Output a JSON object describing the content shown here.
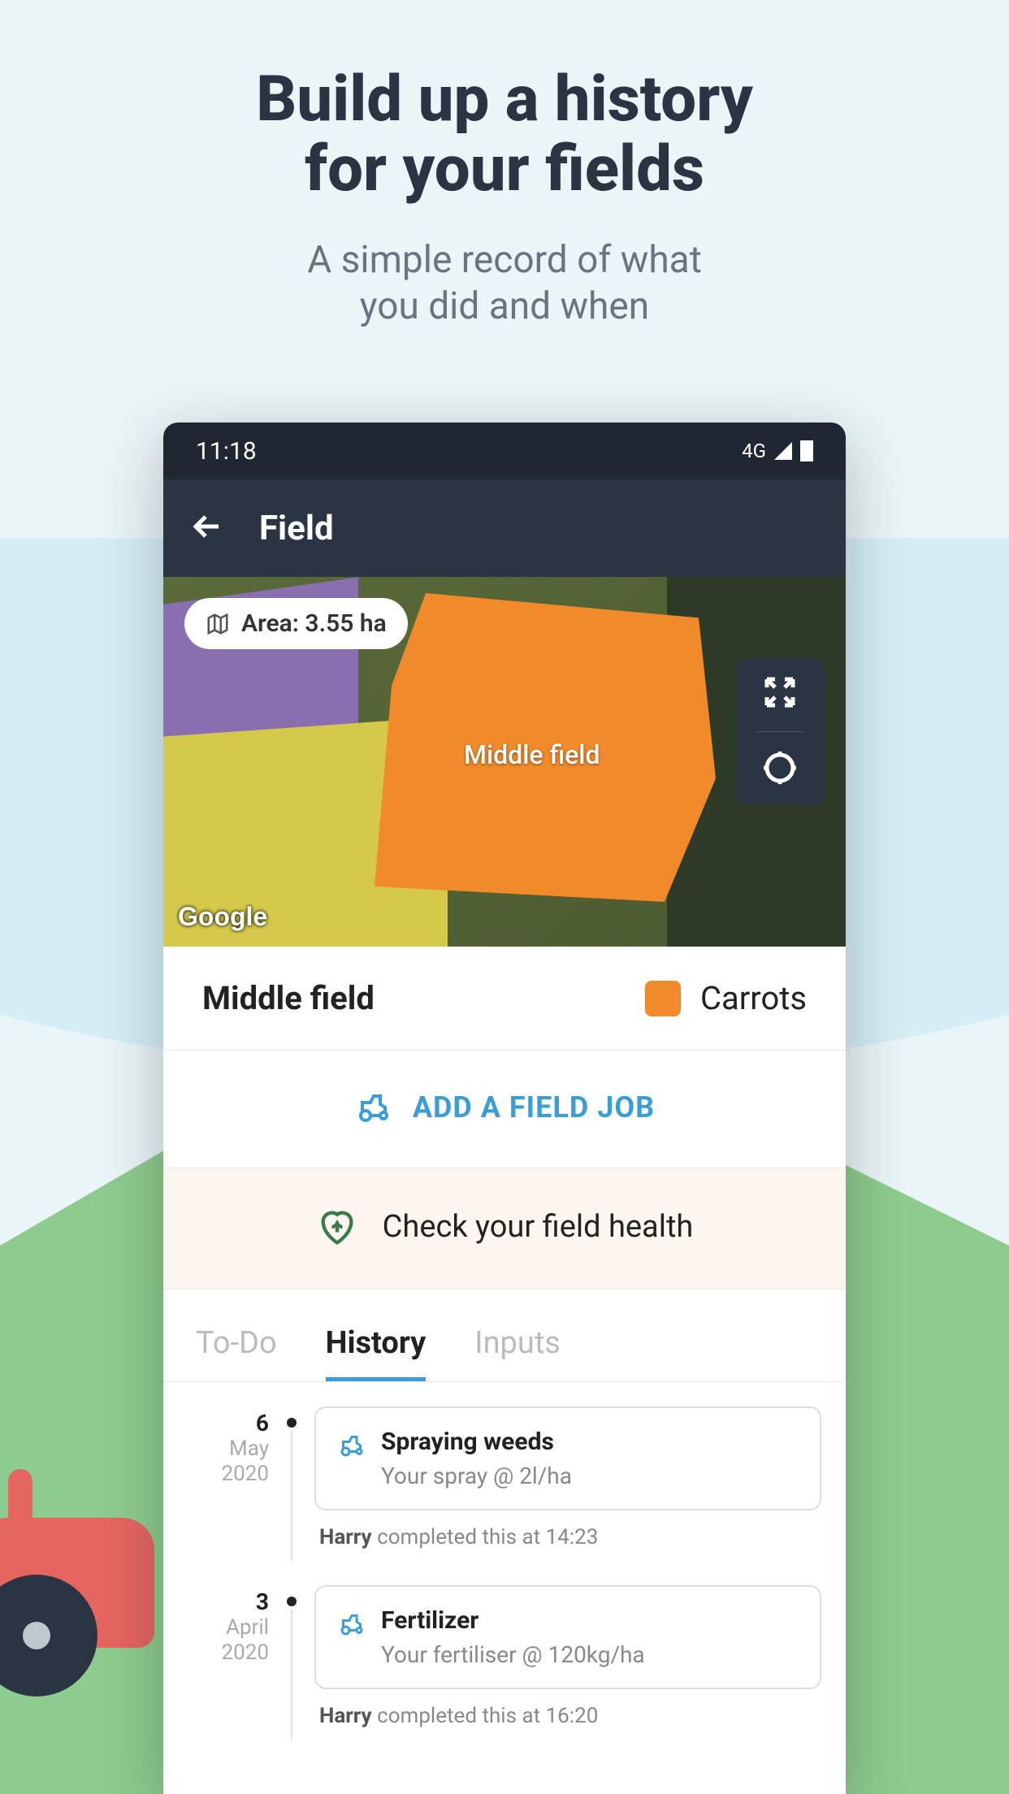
{
  "promo": {
    "title_l1": "Build up a history",
    "title_l2": "for your fields",
    "sub_l1": "A simple record of what",
    "sub_l2": "you did and when"
  },
  "status": {
    "time": "11:18",
    "network": "4G"
  },
  "appbar": {
    "title": "Field"
  },
  "map": {
    "area_label": "Area: 3.55 ha",
    "field_label": "Middle field",
    "watermark": "Google"
  },
  "field_info": {
    "name": "Middle field",
    "crop": "Carrots",
    "crop_color": "#f08a2a"
  },
  "actions": {
    "add_job": "ADD A FIELD JOB",
    "health": "Check your field health"
  },
  "tabs": [
    "To-Do",
    "History",
    "Inputs"
  ],
  "active_tab": "History",
  "history": [
    {
      "day": "6",
      "month": "May",
      "year": "2020",
      "title": "Spraying weeds",
      "detail": "Your spray @ 2l/ha",
      "completed_by": "Harry",
      "completed_at": "14:23"
    },
    {
      "day": "3",
      "month": "April",
      "year": "2020",
      "title": "Fertilizer",
      "detail": "Your fertiliser @ 120kg/ha",
      "completed_by": "Harry",
      "completed_at": "16:20"
    }
  ]
}
